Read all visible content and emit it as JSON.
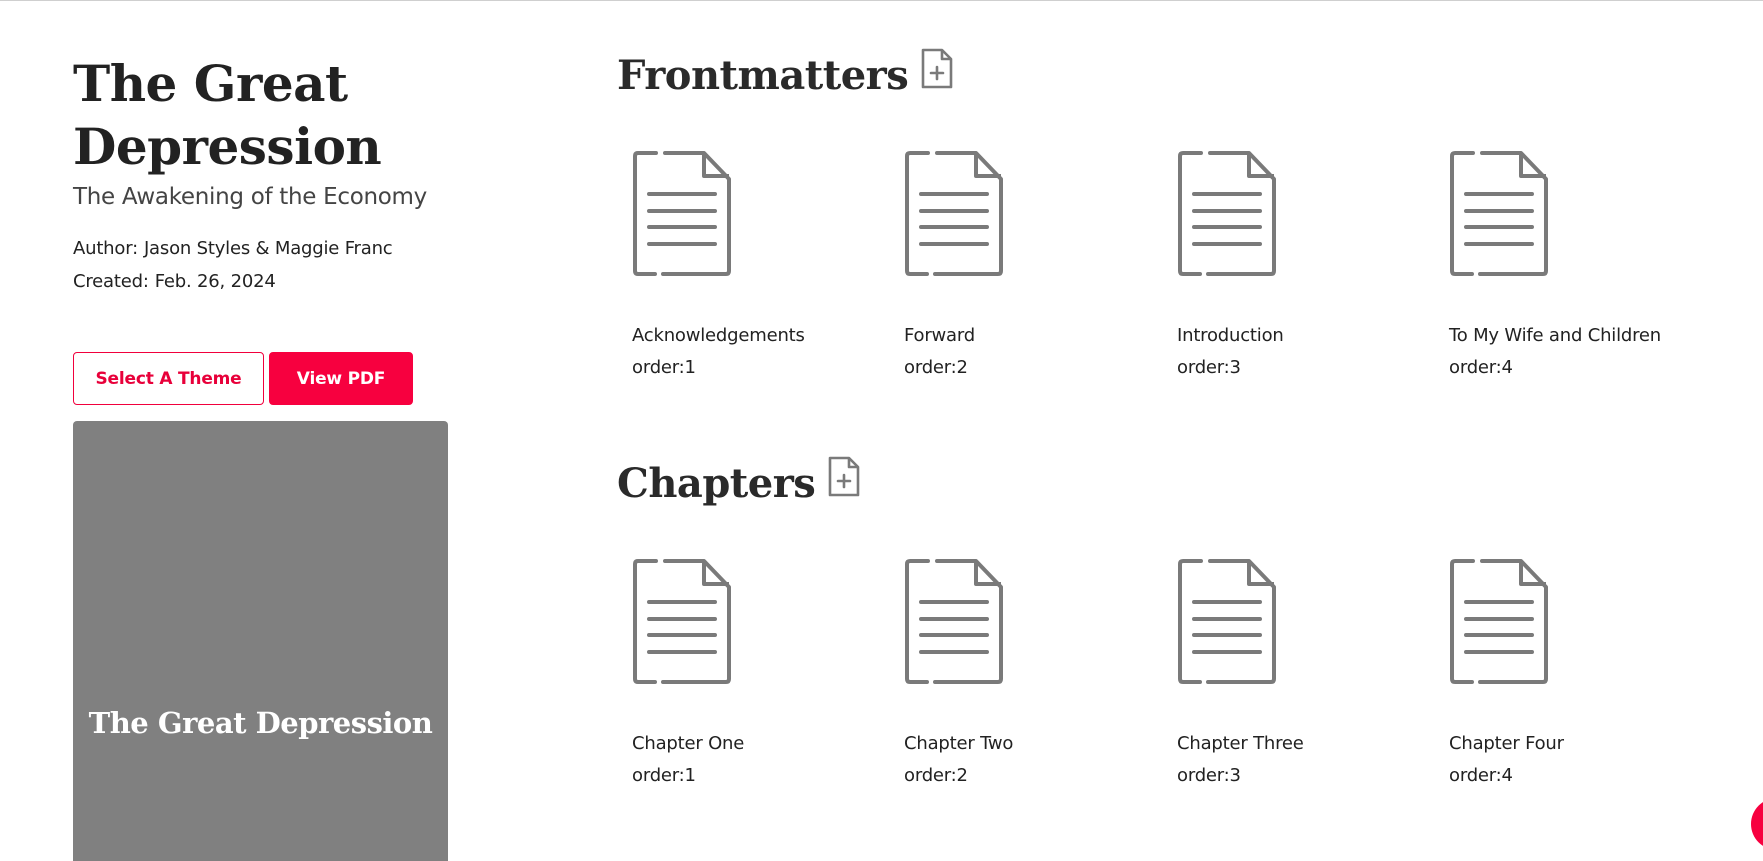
{
  "book": {
    "title": "The Great Depression",
    "subtitle": "The Awakening of the Economy",
    "author_label": "Author:",
    "author": "Jason Styles & Maggie Franc",
    "created_label": "Created:",
    "created": "Feb. 26, 2024"
  },
  "actions": {
    "select_theme_label": "Select A Theme",
    "view_pdf_label": "View PDF"
  },
  "cover": {
    "title": "The Great Depression",
    "background": "#808080"
  },
  "frontmatters": {
    "title": "Frontmatters",
    "add_icon": "file-plus-icon",
    "items": [
      {
        "name": "Acknowledgements",
        "order": "order:1",
        "icon": "document-icon"
      },
      {
        "name": "Forward",
        "order": "order:2",
        "icon": "document-icon"
      },
      {
        "name": "Introduction",
        "order": "order:3",
        "icon": "document-icon"
      },
      {
        "name": "To My Wife and Children",
        "order": "order:4",
        "icon": "document-icon"
      }
    ]
  },
  "chapters": {
    "title": "Chapters",
    "add_icon": "file-plus-icon",
    "items": [
      {
        "name": "Chapter One",
        "order": "order:1",
        "icon": "document-icon"
      },
      {
        "name": "Chapter Two",
        "order": "order:2",
        "icon": "document-icon"
      },
      {
        "name": "Chapter Three",
        "order": "order:3",
        "icon": "document-icon"
      },
      {
        "name": "Chapter Four",
        "order": "order:4",
        "icon": "document-icon"
      }
    ]
  },
  "colors": {
    "accent": "#f7003f",
    "icon": "#7a7a7a",
    "text": "#2a2a2a"
  }
}
